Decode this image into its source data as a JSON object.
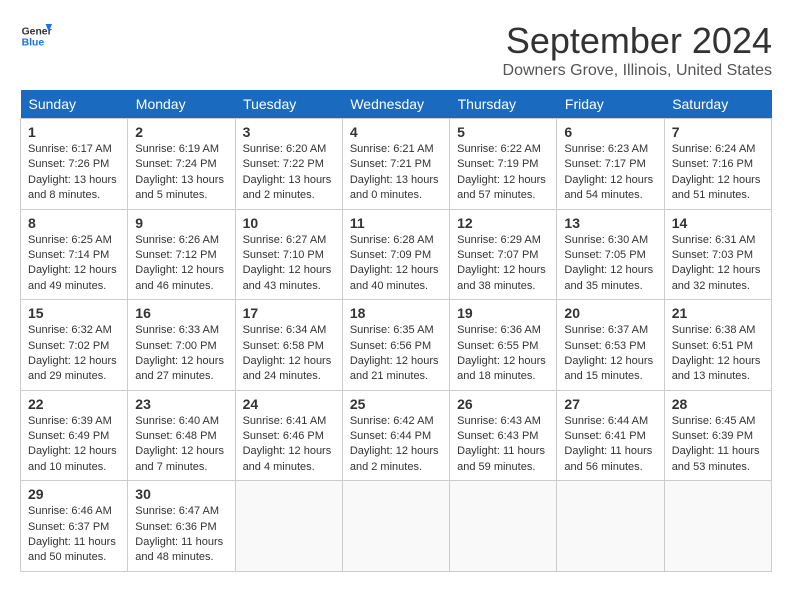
{
  "header": {
    "logo_line1": "General",
    "logo_line2": "Blue",
    "month": "September 2024",
    "location": "Downers Grove, Illinois, United States"
  },
  "days_of_week": [
    "Sunday",
    "Monday",
    "Tuesday",
    "Wednesday",
    "Thursday",
    "Friday",
    "Saturday"
  ],
  "weeks": [
    [
      {
        "day": "1",
        "info": "Sunrise: 6:17 AM\nSunset: 7:26 PM\nDaylight: 13 hours and 8 minutes."
      },
      {
        "day": "2",
        "info": "Sunrise: 6:19 AM\nSunset: 7:24 PM\nDaylight: 13 hours and 5 minutes."
      },
      {
        "day": "3",
        "info": "Sunrise: 6:20 AM\nSunset: 7:22 PM\nDaylight: 13 hours and 2 minutes."
      },
      {
        "day": "4",
        "info": "Sunrise: 6:21 AM\nSunset: 7:21 PM\nDaylight: 13 hours and 0 minutes."
      },
      {
        "day": "5",
        "info": "Sunrise: 6:22 AM\nSunset: 7:19 PM\nDaylight: 12 hours and 57 minutes."
      },
      {
        "day": "6",
        "info": "Sunrise: 6:23 AM\nSunset: 7:17 PM\nDaylight: 12 hours and 54 minutes."
      },
      {
        "day": "7",
        "info": "Sunrise: 6:24 AM\nSunset: 7:16 PM\nDaylight: 12 hours and 51 minutes."
      }
    ],
    [
      {
        "day": "8",
        "info": "Sunrise: 6:25 AM\nSunset: 7:14 PM\nDaylight: 12 hours and 49 minutes."
      },
      {
        "day": "9",
        "info": "Sunrise: 6:26 AM\nSunset: 7:12 PM\nDaylight: 12 hours and 46 minutes."
      },
      {
        "day": "10",
        "info": "Sunrise: 6:27 AM\nSunset: 7:10 PM\nDaylight: 12 hours and 43 minutes."
      },
      {
        "day": "11",
        "info": "Sunrise: 6:28 AM\nSunset: 7:09 PM\nDaylight: 12 hours and 40 minutes."
      },
      {
        "day": "12",
        "info": "Sunrise: 6:29 AM\nSunset: 7:07 PM\nDaylight: 12 hours and 38 minutes."
      },
      {
        "day": "13",
        "info": "Sunrise: 6:30 AM\nSunset: 7:05 PM\nDaylight: 12 hours and 35 minutes."
      },
      {
        "day": "14",
        "info": "Sunrise: 6:31 AM\nSunset: 7:03 PM\nDaylight: 12 hours and 32 minutes."
      }
    ],
    [
      {
        "day": "15",
        "info": "Sunrise: 6:32 AM\nSunset: 7:02 PM\nDaylight: 12 hours and 29 minutes."
      },
      {
        "day": "16",
        "info": "Sunrise: 6:33 AM\nSunset: 7:00 PM\nDaylight: 12 hours and 27 minutes."
      },
      {
        "day": "17",
        "info": "Sunrise: 6:34 AM\nSunset: 6:58 PM\nDaylight: 12 hours and 24 minutes."
      },
      {
        "day": "18",
        "info": "Sunrise: 6:35 AM\nSunset: 6:56 PM\nDaylight: 12 hours and 21 minutes."
      },
      {
        "day": "19",
        "info": "Sunrise: 6:36 AM\nSunset: 6:55 PM\nDaylight: 12 hours and 18 minutes."
      },
      {
        "day": "20",
        "info": "Sunrise: 6:37 AM\nSunset: 6:53 PM\nDaylight: 12 hours and 15 minutes."
      },
      {
        "day": "21",
        "info": "Sunrise: 6:38 AM\nSunset: 6:51 PM\nDaylight: 12 hours and 13 minutes."
      }
    ],
    [
      {
        "day": "22",
        "info": "Sunrise: 6:39 AM\nSunset: 6:49 PM\nDaylight: 12 hours and 10 minutes."
      },
      {
        "day": "23",
        "info": "Sunrise: 6:40 AM\nSunset: 6:48 PM\nDaylight: 12 hours and 7 minutes."
      },
      {
        "day": "24",
        "info": "Sunrise: 6:41 AM\nSunset: 6:46 PM\nDaylight: 12 hours and 4 minutes."
      },
      {
        "day": "25",
        "info": "Sunrise: 6:42 AM\nSunset: 6:44 PM\nDaylight: 12 hours and 2 minutes."
      },
      {
        "day": "26",
        "info": "Sunrise: 6:43 AM\nSunset: 6:43 PM\nDaylight: 11 hours and 59 minutes."
      },
      {
        "day": "27",
        "info": "Sunrise: 6:44 AM\nSunset: 6:41 PM\nDaylight: 11 hours and 56 minutes."
      },
      {
        "day": "28",
        "info": "Sunrise: 6:45 AM\nSunset: 6:39 PM\nDaylight: 11 hours and 53 minutes."
      }
    ],
    [
      {
        "day": "29",
        "info": "Sunrise: 6:46 AM\nSunset: 6:37 PM\nDaylight: 11 hours and 50 minutes."
      },
      {
        "day": "30",
        "info": "Sunrise: 6:47 AM\nSunset: 6:36 PM\nDaylight: 11 hours and 48 minutes."
      },
      {
        "day": "",
        "info": ""
      },
      {
        "day": "",
        "info": ""
      },
      {
        "day": "",
        "info": ""
      },
      {
        "day": "",
        "info": ""
      },
      {
        "day": "",
        "info": ""
      }
    ]
  ]
}
